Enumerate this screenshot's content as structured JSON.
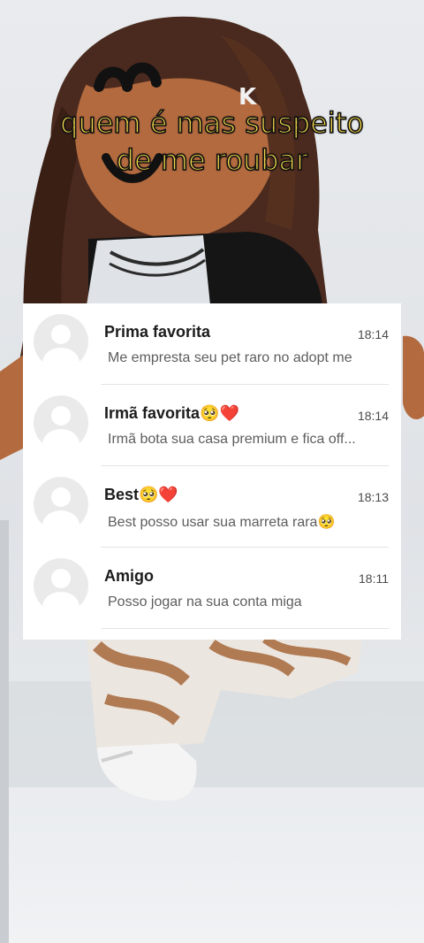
{
  "caption": {
    "line1": "quem é mas suspeito",
    "line2": "de me roubar"
  },
  "chats": [
    {
      "name": "Prima favorita",
      "time": "18:14",
      "preview": "Me empresta seu pet raro no adopt me"
    },
    {
      "name": "Irmã favorita🥺❤️",
      "time": "18:14",
      "preview": "Irmã bota sua casa premium e fica off..."
    },
    {
      "name": "Best🥺❤️",
      "time": "18:13",
      "preview": "Best posso usar sua marreta rara🥺"
    },
    {
      "name": "Amigo",
      "time": "18:11",
      "preview": "Posso jogar na sua conta miga"
    }
  ],
  "background": {
    "watermark_letter": "K"
  }
}
